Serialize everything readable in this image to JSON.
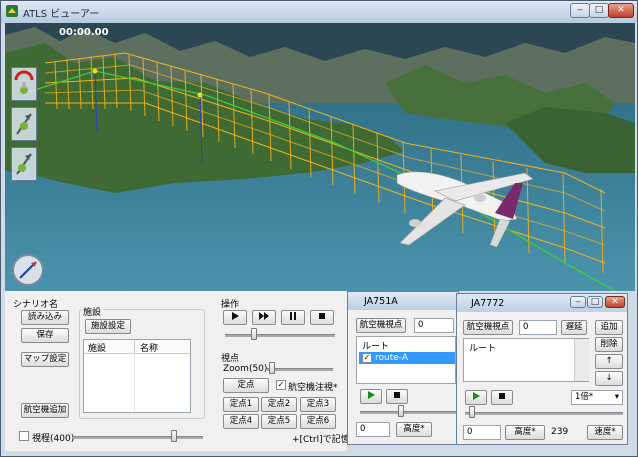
{
  "window": {
    "title": "ATLS ビューアー"
  },
  "viewport": {
    "timer": "00:00.00"
  },
  "scenario": {
    "label": "シナリオ名",
    "load": "読み込み",
    "save": "保存",
    "map_settings": "マップ設定",
    "add_aircraft": "航空機追加",
    "range_checkbox": "視程(400)"
  },
  "facilities": {
    "label": "施設",
    "settings_button": "施設設定",
    "columns": [
      "施設",
      "名称"
    ]
  },
  "operation": {
    "label": "操作"
  },
  "viewpoint": {
    "label": "視点",
    "zoom": "Zoom(50)",
    "fixed_point": "定点",
    "watch_aircraft": "航空機注視*",
    "points": [
      "定点1",
      "定点2",
      "定点3",
      "定点4",
      "定点5",
      "定点6"
    ],
    "hint": "+[Ctrl]で記憶"
  },
  "ja751a": {
    "title": "JA751A",
    "viewpoint_button": "航空機視点",
    "value": "0",
    "route_label": "ルート",
    "route_item": "route-A",
    "position_value": "0",
    "altitude_button": "高度*"
  },
  "ja7772": {
    "title": "JA7772",
    "viewpoint_button": "航空機視点",
    "value": "0",
    "delay_button": "遅延",
    "add_button": "追加",
    "delete_button": "削除",
    "up_button": "↑",
    "down_button": "↓",
    "route_label": "ルート",
    "speed_select": "1倍*",
    "position_value": "0",
    "altitude_button": "高度*",
    "altitude_value": "239",
    "speed_button": "速度*"
  },
  "colors": {
    "sea": "#3a7d95",
    "sky": "#3d5a6a",
    "land": "#4a6e3a",
    "grid": "#f0b020",
    "route_line": "#3ccd3c",
    "selected_row": "#3399ff",
    "play_green": "#1e8a1e"
  }
}
